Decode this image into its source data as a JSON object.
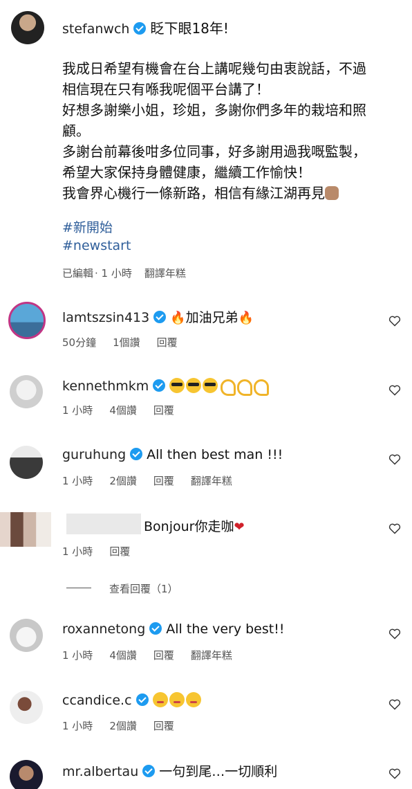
{
  "post": {
    "username": "stefanwch",
    "headline": "眨下眼18年!",
    "lines": [
      "我成日希望有機會在台上講呢幾句由衷說話，不過",
      "相信現在只有喺我呢個平台講了！",
      "好想多謝樂小姐，珍姐，多謝你們多年的栽培和照",
      "顧。",
      "多謝台前幕後咁多位同事，好多謝用過我嘅監製，",
      "希望大家保持身體健康，繼續工作愉快！",
      "我會界心機行一條新路，相信有緣江湖再見"
    ],
    "hashtags": [
      "#新開始",
      "#newstart"
    ],
    "meta": {
      "edited": "已編輯",
      "time": "· 1 小時",
      "translate": "翻譯年糕"
    }
  },
  "comments": [
    {
      "username": "lamtszsin413",
      "verified": true,
      "text": "加油兄弟",
      "time": "50分鐘",
      "likes": "1個讚",
      "reply": "回覆",
      "translate": ""
    },
    {
      "username": "kennethmkm",
      "verified": true,
      "text": "",
      "time": "1 小時",
      "likes": "4個讚",
      "reply": "回覆",
      "translate": ""
    },
    {
      "username": "guruhung",
      "verified": true,
      "text": "All then best man !!!",
      "time": "1 小時",
      "likes": "2個讚",
      "reply": "回覆",
      "translate": "翻譯年糕"
    },
    {
      "username": "",
      "verified": false,
      "text": "Bonjour你走咖",
      "time": "1 小時",
      "likes": "",
      "reply": "回覆",
      "translate": ""
    },
    {
      "username": "roxannetong",
      "verified": true,
      "text": "All the very best!!",
      "time": "1 小時",
      "likes": "4個讚",
      "reply": "回覆",
      "translate": "翻譯年糕"
    },
    {
      "username": "ccandice.c",
      "verified": true,
      "text": "",
      "time": "1 小時",
      "likes": "2個讚",
      "reply": "回覆",
      "translate": ""
    },
    {
      "username": "mr.albertau",
      "verified": true,
      "text": "一句到尾…一切順利",
      "time": "",
      "likes": "",
      "reply": "",
      "translate": ""
    }
  ],
  "view_replies": "查看回覆（1）",
  "colors": {
    "verified": "#1d9bf0",
    "hashtag": "#2f5e9a",
    "meta": "#555555"
  }
}
